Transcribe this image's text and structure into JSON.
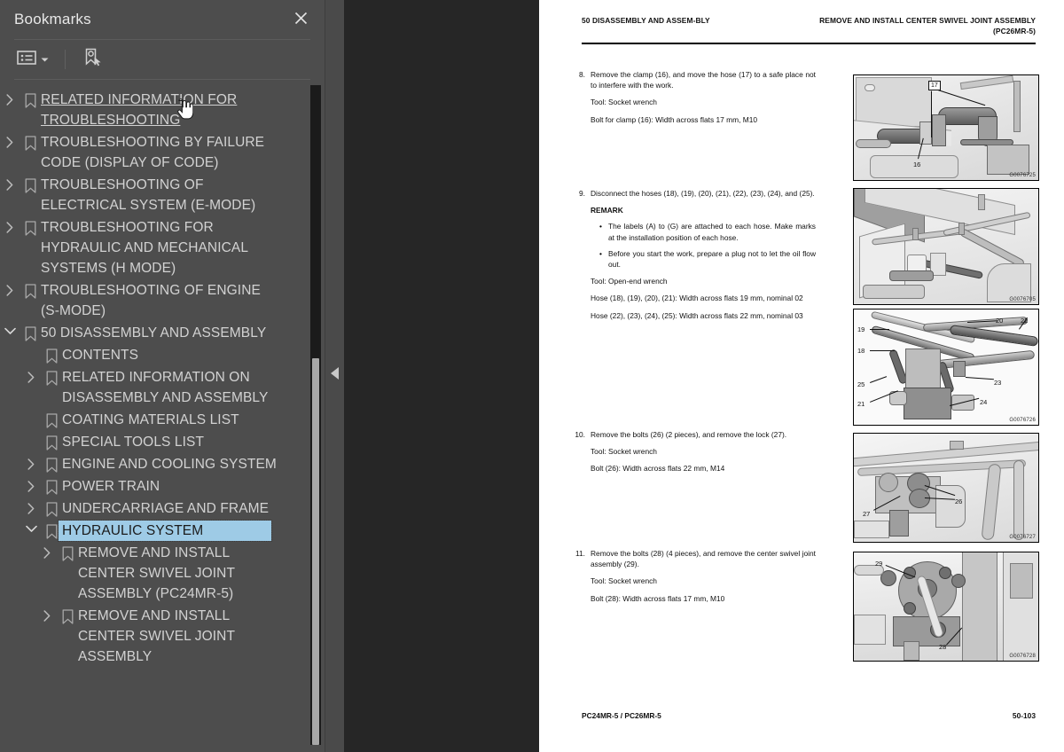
{
  "panel": {
    "title": "Bookmarks",
    "close_icon": "close-icon",
    "toolbar": {
      "options_icon": "list-options-icon",
      "dropdown_icon": "chevron-down-icon",
      "new_bookmark_icon": "new-bookmark-icon"
    }
  },
  "tree": [
    {
      "label": "RELATED INFORMATION FOR TROUBLESHOOTING",
      "level": 1,
      "twisty": "collapsed",
      "state": "hover"
    },
    {
      "label": "TROUBLESHOOTING BY FAILURE CODE (DISPLAY OF CODE)",
      "level": 1,
      "twisty": "collapsed",
      "state": "normal"
    },
    {
      "label": "TROUBLESHOOTING OF ELECTRICAL SYSTEM (E-MODE)",
      "level": 1,
      "twisty": "collapsed",
      "state": "normal"
    },
    {
      "label": "TROUBLESHOOTING FOR HYDRAULIC AND MECHANICAL SYSTEMS (H MODE)",
      "level": 1,
      "twisty": "collapsed",
      "state": "normal"
    },
    {
      "label": "TROUBLESHOOTING OF ENGINE (S-MODE)",
      "level": 1,
      "twisty": "collapsed",
      "state": "normal"
    },
    {
      "label": "50 DISASSEMBLY AND ASSEMBLY",
      "level": 1,
      "twisty": "expanded",
      "state": "normal"
    },
    {
      "label": "CONTENTS",
      "level": 2,
      "twisty": "none",
      "state": "normal"
    },
    {
      "label": "RELATED INFORMATION ON DISASSEMBLY AND ASSEMBLY",
      "level": 2,
      "twisty": "collapsed",
      "state": "normal"
    },
    {
      "label": "COATING MATERIALS LIST",
      "level": 2,
      "twisty": "none",
      "state": "normal"
    },
    {
      "label": "SPECIAL TOOLS LIST",
      "level": 2,
      "twisty": "none",
      "state": "normal"
    },
    {
      "label": "ENGINE AND COOLING SYSTEM",
      "level": 2,
      "twisty": "collapsed",
      "state": "normal"
    },
    {
      "label": "POWER TRAIN",
      "level": 2,
      "twisty": "collapsed",
      "state": "normal"
    },
    {
      "label": "UNDERCARRIAGE AND FRAME",
      "level": 2,
      "twisty": "collapsed",
      "state": "normal"
    },
    {
      "label": "HYDRAULIC SYSTEM",
      "level": 2,
      "twisty": "expanded",
      "state": "selected"
    },
    {
      "label": "REMOVE AND INSTALL CENTER SWIVEL JOINT ASSEMBLY (PC24MR-5)",
      "level": 3,
      "twisty": "collapsed",
      "state": "normal"
    },
    {
      "label": "REMOVE AND INSTALL CENTER SWIVEL JOINT ASSEMBLY",
      "level": 3,
      "twisty": "collapsed",
      "state": "normal"
    }
  ],
  "divider": {
    "collapse_icon": "collapse-left-icon"
  },
  "document": {
    "header_left": "50 DISASSEMBLY AND ASSEM-BLY",
    "header_right_line1": "REMOVE AND INSTALL CENTER SWIVEL JOINT ASSEMBLY",
    "header_right_line2": "(PC26MR-5)",
    "footer_left": "PC24MR-5 / PC26MR-5",
    "footer_right": "50-103",
    "steps": [
      {
        "number": "8.",
        "lines": [
          "Remove the clamp (16), and move the hose (17) to a safe place not to interfere with the work.",
          "Tool: Socket wrench",
          "Bolt for clamp (16): Width across flats 17 mm, M10"
        ],
        "bullets": [],
        "remark_label": "",
        "figure": {
          "code": "G0076725",
          "callouts": [
            "17",
            "16"
          ]
        }
      },
      {
        "number": "9.",
        "lines": [
          "Disconnect the hoses (18), (19), (20), (21), (22), (23), (24), and (25).",
          "Tool: Open-end wrench",
          "Hose (18), (19), (20), (21): Width across flats 19 mm, nominal 02",
          "Hose (22), (23), (24), (25): Width across flats 22 mm, nominal 03"
        ],
        "remark_label": "REMARK",
        "bullets": [
          "The labels (A) to (G) are attached to each hose. Make marks at the installation position of each hose.",
          "Before you start the work, prepare a plug not to let the oil flow out."
        ],
        "figure": {
          "code": "G0076705",
          "callouts": []
        },
        "figure2": {
          "code": "G0076726",
          "callouts": [
            "19",
            "18",
            "25",
            "21",
            "20",
            "22",
            "23",
            "24"
          ]
        }
      },
      {
        "number": "10.",
        "lines": [
          "Remove the bolts (26) (2 pieces), and remove the lock (27).",
          "Tool: Socket wrench",
          "Bolt (26): Width across flats 22 mm, M14"
        ],
        "bullets": [],
        "remark_label": "",
        "figure": {
          "code": "G0076727",
          "callouts": [
            "26",
            "27"
          ]
        }
      },
      {
        "number": "11.",
        "lines": [
          "Remove the bolts (28) (4 pieces), and remove the center swivel joint assembly (29).",
          "Tool: Socket wrench",
          "Bolt (28): Width across flats 17 mm, M10"
        ],
        "bullets": [],
        "remark_label": "",
        "figure": {
          "code": "G0076728",
          "callouts": [
            "29",
            "28"
          ]
        }
      }
    ]
  },
  "colors": {
    "panel_bg": "#4d4d4d",
    "viewer_bg": "#262626",
    "selection": "#9ecbe6",
    "text": "#d2d2d2"
  }
}
